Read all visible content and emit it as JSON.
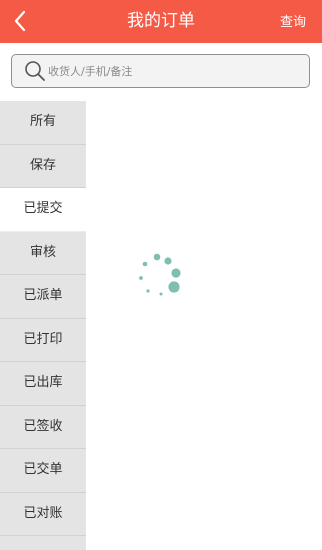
{
  "header": {
    "title": "我的订单",
    "query_label": "查询",
    "back_icon": "chevron-left-icon",
    "color": "#f55a47"
  },
  "search": {
    "placeholder": "收货人/手机/备注",
    "value": "",
    "icon": "search-icon"
  },
  "sidebar": {
    "active_index": 2,
    "items": [
      {
        "label": "所有"
      },
      {
        "label": "保存"
      },
      {
        "label": "已提交"
      },
      {
        "label": "审核"
      },
      {
        "label": "已派单"
      },
      {
        "label": "已打印"
      },
      {
        "label": "已出库"
      },
      {
        "label": "已签收"
      },
      {
        "label": "已交单"
      },
      {
        "label": "已对账"
      }
    ]
  },
  "content": {
    "loading_icon": "loading-spinner-icon",
    "spinner_color": "#7fbfb1"
  }
}
